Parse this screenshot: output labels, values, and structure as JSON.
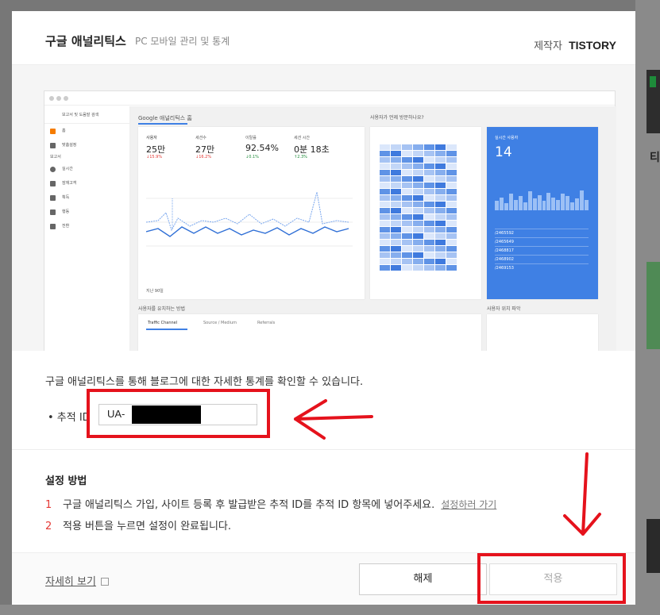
{
  "modal": {
    "title": "구글 애널리틱스",
    "subtitle": "PC 모바일 관리 및 통계",
    "maker_label": "제작자",
    "maker_value": "TISTORY"
  },
  "preview": {
    "search_hint": "보고서 및 도움말 검색",
    "side_items": [
      "홈",
      "맞춤설정",
      "보고서",
      "실시간",
      "잠재고객",
      "획득",
      "행동",
      "전환"
    ],
    "home_title": "Google 애널리틱스 홈",
    "visit_title": "사용자가 언제 방문하나요?",
    "acq_title": "사용자를 유치하는 방법",
    "loc_title": "사용자 위치 파악",
    "metrics": [
      {
        "label": "사용자",
        "value": "25만",
        "delta": "↓15.9%"
      },
      {
        "label": "세션수",
        "value": "27만",
        "delta": "↓16.2%"
      },
      {
        "label": "이탈률",
        "value": "92.54%",
        "delta": "↓0.1%"
      },
      {
        "label": "세션 시간",
        "value": "0분 18초",
        "delta": "↑2.3%"
      }
    ],
    "period": "지난 90일",
    "realtime_label": "실시간 사용자",
    "realtime_value": "14",
    "pages": [
      "/2465592",
      "/2465649",
      "/2468817",
      "/2468902",
      "/2469153"
    ],
    "tabs": [
      "Traffic Channel",
      "Source / Medium",
      "Referrals"
    ]
  },
  "form": {
    "description": "구글 애널리틱스를 통해 블로그에 대한 자세한 통계를 확인할 수 있습니다.",
    "track_label": "• 추적 ID",
    "track_value": "UA-"
  },
  "setup": {
    "heading": "설정 방법",
    "step1_num": "1",
    "step1_text": "구글 애널리틱스 가입, 사이트 등록 후 발급받은 추적 ID를 추적 ID 항목에 넣어주세요.",
    "step1_link": "설정하러 가기",
    "step2_num": "2",
    "step2_text": "적용 버튼을 누르면 설정이 완료됩니다."
  },
  "footer": {
    "more_link": "자세히 보기",
    "release_button": "해제",
    "apply_button": "적용"
  },
  "colors": {
    "annotation_red": "#e5121c",
    "step_number": "#e53935",
    "ga_blue": "#3f80e4"
  }
}
